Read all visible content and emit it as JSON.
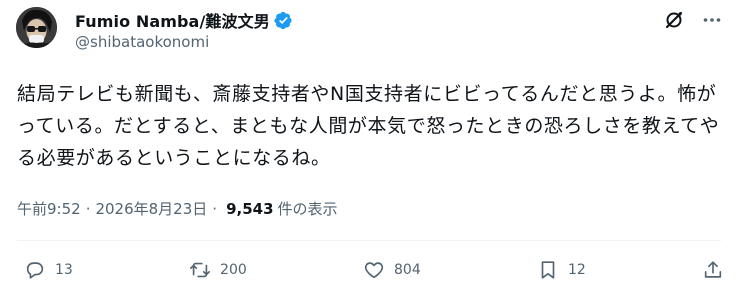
{
  "author": {
    "display_name": "Fumio Namba/難波文男",
    "handle": "@shibataokonomi",
    "verified": true
  },
  "header_icons": [
    "grok-icon",
    "more-icon"
  ],
  "tweet": {
    "text": "結局テレビも新聞も、斎藤支持者やN国支持者にビビってるんだと思うよ。怖がっている。だとすると、まともな人間が本気で怒ったときの恐ろしさを教えてやる必要があるということになるね。"
  },
  "meta": {
    "time": "午前9:52",
    "separator": "·",
    "date": "2026年8月23日",
    "views_count": "9,543",
    "views_label": "件の表示"
  },
  "actions": {
    "replies": "13",
    "retweets": "200",
    "likes": "804",
    "bookmarks": "12"
  },
  "colors": {
    "text": "#0f1419",
    "muted": "#536471",
    "verified": "#1d9bf0"
  }
}
